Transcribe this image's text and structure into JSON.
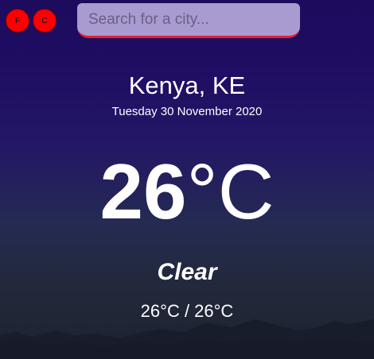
{
  "unit_toggle": {
    "fahrenheit_label": "F",
    "celsius_label": "C"
  },
  "search": {
    "placeholder": "Search for a city...",
    "value": ""
  },
  "weather": {
    "location": "Kenya, KE",
    "date": "Tuesday 30 November 2020",
    "temperature": "26",
    "temperature_unit": "°C",
    "condition": "Clear",
    "range": "26°C / 26°C"
  },
  "colors": {
    "unit_button": "#ff0000",
    "search_underline": "#e02030",
    "search_bg": "#a99bd0",
    "bg_top": "#1d0b5e",
    "bg_bottom": "#1c2230"
  }
}
